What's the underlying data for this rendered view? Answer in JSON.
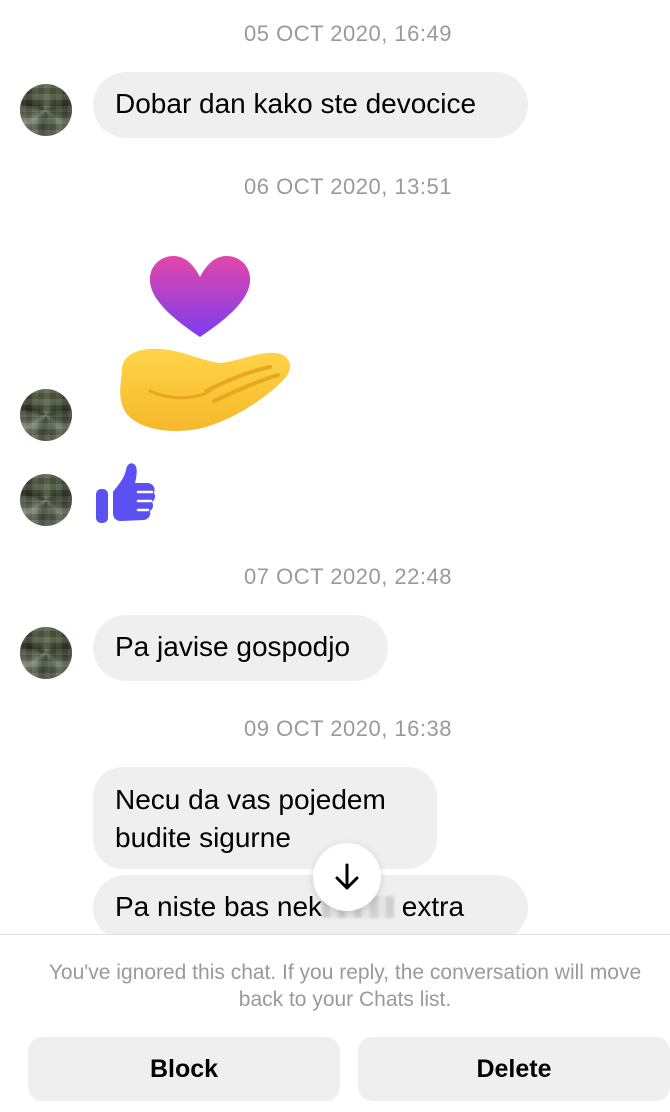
{
  "messages": [
    {
      "timestamp": "05 OCT 2020, 16:49",
      "text": "Dobar dan kako ste devocice"
    },
    {
      "timestamp": "06 OCT 2020, 13:51",
      "sticker": "heart-on-hand-icon"
    },
    {
      "like": "thumbs-up-icon"
    },
    {
      "timestamp": "07 OCT 2020, 22:48",
      "text": "Pa javise gospodjo"
    },
    {
      "timestamp": "09 OCT 2020, 16:38",
      "lines": [
        "Necu da vas pojedem",
        "budite sigurne"
      ]
    },
    {
      "text_before": "Pa niste bas nek",
      "text_after": " extra",
      "redacted": true
    }
  ],
  "footer": {
    "notice": "You've ignored this chat. If you reply, the conversation will move back to your Chats list.",
    "block_label": "Block",
    "delete_label": "Delete"
  },
  "colors": {
    "bubble": "#efefef",
    "timestamp": "#9a9a9a",
    "like": "#5b51f2",
    "heart_top": "#e247a8",
    "heart_bottom": "#7a3df0",
    "hand": "#ffc83d"
  }
}
